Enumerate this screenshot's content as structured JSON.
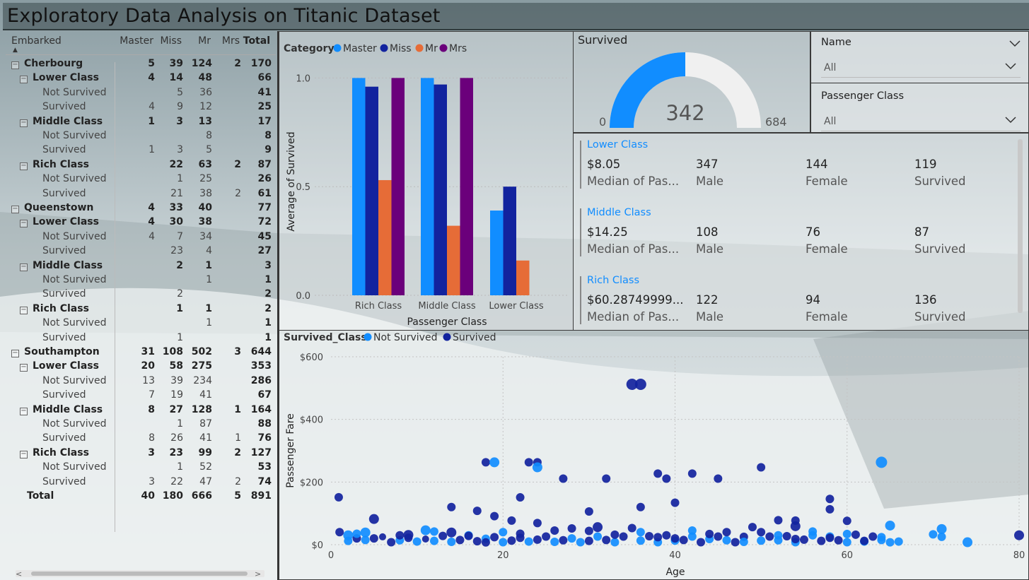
{
  "title": "Exploratory Data Analysis on Titanic Dataset",
  "matrix": {
    "headers": [
      "Embarked",
      "Master",
      "Miss",
      "Mr",
      "Mrs",
      "Total"
    ],
    "rows": [
      {
        "level": 0,
        "label": "Cherbourg",
        "v": [
          "5",
          "39",
          "124",
          "2",
          "170"
        ]
      },
      {
        "level": 1,
        "label": "Lower Class",
        "v": [
          "4",
          "14",
          "48",
          "",
          "66"
        ]
      },
      {
        "level": 2,
        "label": "Not Survived",
        "v": [
          "",
          "5",
          "36",
          "",
          "41"
        ]
      },
      {
        "level": 2,
        "label": "Survived",
        "v": [
          "4",
          "9",
          "12",
          "",
          "25"
        ]
      },
      {
        "level": 1,
        "label": "Middle Class",
        "v": [
          "1",
          "3",
          "13",
          "",
          "17"
        ]
      },
      {
        "level": 2,
        "label": "Not Survived",
        "v": [
          "",
          "",
          "8",
          "",
          "8"
        ]
      },
      {
        "level": 2,
        "label": "Survived",
        "v": [
          "1",
          "3",
          "5",
          "",
          "9"
        ]
      },
      {
        "level": 1,
        "label": "Rich Class",
        "v": [
          "",
          "22",
          "63",
          "2",
          "87"
        ]
      },
      {
        "level": 2,
        "label": "Not Survived",
        "v": [
          "",
          "1",
          "25",
          "",
          "26"
        ]
      },
      {
        "level": 2,
        "label": "Survived",
        "v": [
          "",
          "21",
          "38",
          "2",
          "61"
        ]
      },
      {
        "level": 0,
        "label": "Queenstown",
        "v": [
          "4",
          "33",
          "40",
          "",
          "77"
        ]
      },
      {
        "level": 1,
        "label": "Lower Class",
        "v": [
          "4",
          "30",
          "38",
          "",
          "72"
        ]
      },
      {
        "level": 2,
        "label": "Not Survived",
        "v": [
          "4",
          "7",
          "34",
          "",
          "45"
        ]
      },
      {
        "level": 2,
        "label": "Survived",
        "v": [
          "",
          "23",
          "4",
          "",
          "27"
        ]
      },
      {
        "level": 1,
        "label": "Middle Class",
        "v": [
          "",
          "2",
          "1",
          "",
          "3"
        ]
      },
      {
        "level": 2,
        "label": "Not Survived",
        "v": [
          "",
          "",
          "1",
          "",
          "1"
        ]
      },
      {
        "level": 2,
        "label": "Survived",
        "v": [
          "",
          "2",
          "",
          "",
          "2"
        ]
      },
      {
        "level": 1,
        "label": "Rich Class",
        "v": [
          "",
          "1",
          "1",
          "",
          "2"
        ]
      },
      {
        "level": 2,
        "label": "Not Survived",
        "v": [
          "",
          "",
          "1",
          "",
          "1"
        ]
      },
      {
        "level": 2,
        "label": "Survived",
        "v": [
          "",
          "1",
          "",
          "",
          "1"
        ]
      },
      {
        "level": 0,
        "label": "Southampton",
        "v": [
          "31",
          "108",
          "502",
          "3",
          "644"
        ]
      },
      {
        "level": 1,
        "label": "Lower Class",
        "v": [
          "20",
          "58",
          "275",
          "",
          "353"
        ]
      },
      {
        "level": 2,
        "label": "Not Survived",
        "v": [
          "13",
          "39",
          "234",
          "",
          "286"
        ]
      },
      {
        "level": 2,
        "label": "Survived",
        "v": [
          "7",
          "19",
          "41",
          "",
          "67"
        ]
      },
      {
        "level": 1,
        "label": "Middle Class",
        "v": [
          "8",
          "27",
          "128",
          "1",
          "164"
        ]
      },
      {
        "level": 2,
        "label": "Not Survived",
        "v": [
          "",
          "1",
          "87",
          "",
          "88"
        ]
      },
      {
        "level": 2,
        "label": "Survived",
        "v": [
          "8",
          "26",
          "41",
          "1",
          "76"
        ]
      },
      {
        "level": 1,
        "label": "Rich Class",
        "v": [
          "3",
          "23",
          "99",
          "2",
          "127"
        ]
      },
      {
        "level": 2,
        "label": "Not Survived",
        "v": [
          "",
          "1",
          "52",
          "",
          "53"
        ]
      },
      {
        "level": 2,
        "label": "Survived",
        "v": [
          "3",
          "22",
          "47",
          "2",
          "74"
        ]
      },
      {
        "level": 3,
        "label": "Total",
        "v": [
          "40",
          "180",
          "666",
          "5",
          "891"
        ]
      }
    ],
    "scroll_left": "<",
    "scroll_right": ">"
  },
  "chart_data": [
    {
      "type": "bar",
      "legend_title": "Category",
      "categories": [
        "Rich Class",
        "Middle Class",
        "Lower Class"
      ],
      "series": [
        {
          "name": "Master",
          "color": "#118dff",
          "values": [
            1.0,
            1.0,
            0.39
          ]
        },
        {
          "name": "Miss",
          "color": "#12239e",
          "values": [
            0.96,
            0.97,
            0.5
          ]
        },
        {
          "name": "Mr",
          "color": "#e66c37",
          "values": [
            0.53,
            0.32,
            0.16
          ]
        },
        {
          "name": "Mrs",
          "color": "#6b007b",
          "values": [
            1.0,
            1.0,
            null
          ]
        }
      ],
      "xlabel": "Passenger Class",
      "ylabel": "Average of Survived",
      "yticks": [
        "0.0",
        "0.5",
        "1.0"
      ],
      "ylim": [
        0,
        1.05
      ],
      "legend": "top-left"
    },
    {
      "type": "scatter",
      "legend_title": "Survived_Class",
      "series": [
        {
          "name": "Not Survived",
          "color": "#118dff"
        },
        {
          "name": "Survived",
          "color": "#12239e"
        }
      ],
      "points": [
        [
          0.9,
          151.5,
          1,
          6
        ],
        [
          2,
          30,
          0,
          7
        ],
        [
          4,
          39,
          0,
          7
        ],
        [
          5,
          82,
          1,
          7
        ],
        [
          9,
          31,
          1,
          7
        ],
        [
          11,
          46,
          0,
          7
        ],
        [
          14,
          120,
          1,
          6
        ],
        [
          14,
          39,
          1,
          7
        ],
        [
          17,
          108,
          1,
          6
        ],
        [
          18,
          263,
          1,
          6
        ],
        [
          19,
          263,
          0,
          7
        ],
        [
          19,
          91,
          1,
          6
        ],
        [
          21,
          77,
          1,
          6
        ],
        [
          22,
          151,
          1,
          6
        ],
        [
          23,
          263,
          1,
          6
        ],
        [
          24,
          263,
          1,
          6
        ],
        [
          24,
          247,
          0,
          7
        ],
        [
          24,
          69,
          1,
          6
        ],
        [
          27,
          211,
          1,
          6
        ],
        [
          30,
          106,
          1,
          6
        ],
        [
          31,
          56,
          1,
          7
        ],
        [
          32,
          211,
          1,
          6
        ],
        [
          35,
          512,
          1,
          8
        ],
        [
          36,
          512,
          1,
          8
        ],
        [
          36,
          120,
          1,
          6
        ],
        [
          38,
          227,
          1,
          6
        ],
        [
          39,
          211,
          1,
          6
        ],
        [
          40,
          134,
          1,
          6
        ],
        [
          42,
          227,
          1,
          6
        ],
        [
          45,
          211,
          1,
          6
        ],
        [
          50,
          247,
          1,
          6
        ],
        [
          52,
          78,
          1,
          6
        ],
        [
          54,
          59,
          1,
          7
        ],
        [
          54,
          77,
          1,
          6
        ],
        [
          58,
          146,
          1,
          6
        ],
        [
          58,
          113,
          1,
          6
        ],
        [
          60,
          76,
          1,
          6
        ],
        [
          64,
          263,
          0,
          8
        ],
        [
          65,
          61,
          0,
          7
        ],
        [
          71,
          50,
          0,
          7
        ],
        [
          80,
          30,
          1,
          7
        ],
        [
          74,
          7.8,
          0,
          7
        ],
        [
          2,
          12,
          0,
          6
        ],
        [
          3,
          20,
          1,
          6
        ],
        [
          4,
          15,
          0,
          6
        ],
        [
          6,
          25,
          1,
          5
        ],
        [
          7,
          8,
          1,
          6
        ],
        [
          8,
          14,
          0,
          6
        ],
        [
          9,
          22,
          1,
          6
        ],
        [
          10,
          10,
          0,
          6
        ],
        [
          11,
          18,
          1,
          5
        ],
        [
          12,
          12,
          0,
          6
        ],
        [
          13,
          28,
          1,
          6
        ],
        [
          14,
          9,
          0,
          6
        ],
        [
          15,
          15,
          1,
          6
        ],
        [
          16,
          30,
          0,
          6
        ],
        [
          17,
          11,
          1,
          6
        ],
        [
          18,
          19,
          0,
          6
        ],
        [
          19,
          24,
          1,
          6
        ],
        [
          20,
          8,
          0,
          6
        ],
        [
          21,
          13,
          1,
          6
        ],
        [
          22,
          35,
          1,
          6
        ],
        [
          23,
          10,
          0,
          6
        ],
        [
          24,
          16,
          1,
          6
        ],
        [
          25,
          26,
          1,
          6
        ],
        [
          26,
          9,
          0,
          6
        ],
        [
          27,
          14,
          1,
          6
        ],
        [
          28,
          52,
          1,
          6
        ],
        [
          29,
          8,
          0,
          6
        ],
        [
          30,
          12,
          1,
          6
        ],
        [
          31,
          26,
          0,
          6
        ],
        [
          32,
          15,
          1,
          6
        ],
        [
          33,
          7.9,
          0,
          6
        ],
        [
          34,
          26,
          1,
          6
        ],
        [
          35,
          53,
          1,
          6
        ],
        [
          36,
          13,
          0,
          6
        ],
        [
          37,
          27,
          1,
          6
        ],
        [
          38,
          8,
          0,
          6
        ],
        [
          39,
          30,
          1,
          6
        ],
        [
          40,
          13,
          0,
          6
        ],
        [
          41,
          15,
          1,
          6
        ],
        [
          42,
          26,
          0,
          6
        ],
        [
          43,
          8,
          1,
          6
        ],
        [
          44,
          18,
          0,
          6
        ],
        [
          45,
          26,
          1,
          6
        ],
        [
          46,
          14,
          0,
          6
        ],
        [
          47,
          8,
          1,
          6
        ],
        [
          48,
          25,
          1,
          6
        ],
        [
          49,
          56,
          1,
          6
        ],
        [
          50,
          13,
          0,
          6
        ],
        [
          51,
          26,
          1,
          6
        ],
        [
          52,
          14,
          0,
          6
        ],
        [
          53,
          27,
          1,
          6
        ],
        [
          54,
          8,
          0,
          6
        ],
        [
          55,
          16,
          1,
          6
        ],
        [
          56,
          30,
          0,
          6
        ],
        [
          57,
          12,
          1,
          6
        ],
        [
          58,
          26,
          0,
          6
        ],
        [
          59,
          14,
          1,
          6
        ],
        [
          60,
          8,
          0,
          6
        ],
        [
          61,
          32,
          1,
          6
        ],
        [
          62,
          10,
          0,
          6
        ],
        [
          63,
          26,
          1,
          6
        ],
        [
          64,
          15,
          0,
          6
        ],
        [
          65,
          7.7,
          0,
          6
        ],
        [
          66,
          10,
          0,
          6
        ],
        [
          1,
          40,
          1,
          6
        ],
        [
          3,
          35,
          0,
          6
        ],
        [
          5,
          20,
          1,
          6
        ],
        [
          8,
          30,
          1,
          6
        ],
        [
          12,
          42,
          0,
          6
        ],
        [
          16,
          28,
          1,
          6
        ],
        [
          18,
          7.2,
          1,
          6
        ],
        [
          20,
          40,
          0,
          6
        ],
        [
          22,
          22,
          1,
          6
        ],
        [
          26,
          45,
          1,
          6
        ],
        [
          28,
          20,
          0,
          6
        ],
        [
          30,
          44,
          1,
          6
        ],
        [
          33,
          32,
          1,
          6
        ],
        [
          36,
          40,
          0,
          6
        ],
        [
          38,
          24,
          1,
          6
        ],
        [
          40,
          20,
          1,
          6
        ],
        [
          42,
          45,
          0,
          6
        ],
        [
          44,
          34,
          1,
          6
        ],
        [
          46,
          40,
          1,
          6
        ],
        [
          48,
          9,
          0,
          6
        ],
        [
          50,
          40,
          1,
          6
        ],
        [
          52,
          30,
          0,
          6
        ],
        [
          54,
          18,
          1,
          6
        ],
        [
          56,
          42,
          0,
          6
        ],
        [
          58,
          22,
          1,
          6
        ],
        [
          60,
          34,
          0,
          6
        ],
        [
          62,
          12,
          1,
          6
        ],
        [
          64,
          24,
          0,
          6
        ],
        [
          70,
          33,
          0,
          6
        ],
        [
          71,
          25,
          0,
          6
        ]
      ],
      "xlabel": "Age",
      "ylabel": "Passenger Fare",
      "xticks": [
        "0",
        "20",
        "40",
        "60",
        "80"
      ],
      "yticks": [
        "$0",
        "$200",
        "$400",
        "$600"
      ],
      "xlim": [
        0,
        80
      ],
      "ylim": [
        0,
        600
      ],
      "legend": "top-left"
    }
  ],
  "gauge": {
    "title": "Survived",
    "value": "342",
    "min": "0",
    "max": "684",
    "value_num": 342,
    "max_num": 684,
    "fill_color": "#118dff",
    "track_color": "#f0f0f0"
  },
  "slicers": [
    {
      "title": "Name",
      "value": "All"
    },
    {
      "title": "Passenger Class",
      "value": "All"
    }
  ],
  "cards": [
    {
      "title": "Lower Class",
      "values": [
        "$8.05",
        "347",
        "144",
        "119"
      ],
      "labels": [
        "Median of Pas...",
        "Male",
        "Female",
        "Survived"
      ]
    },
    {
      "title": "Middle Class",
      "values": [
        "$14.25",
        "108",
        "76",
        "87"
      ],
      "labels": [
        "Median of Pas...",
        "Male",
        "Female",
        "Survived"
      ]
    },
    {
      "title": "Rich Class",
      "values": [
        "$60.28749999...",
        "122",
        "94",
        "136"
      ],
      "labels": [
        "Median of Pas...",
        "Male",
        "Female",
        "Survived"
      ]
    }
  ]
}
